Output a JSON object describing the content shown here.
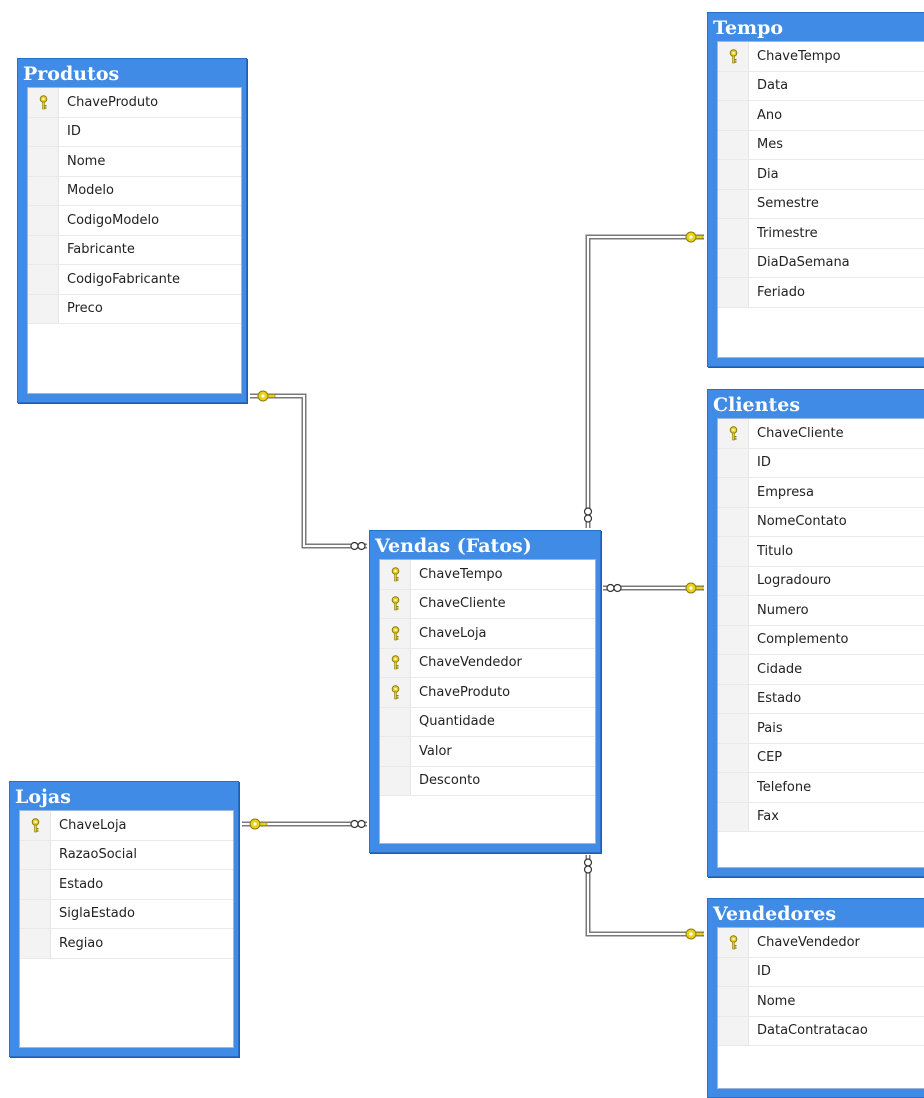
{
  "colors": {
    "table_frame": "#3f8be6",
    "table_title": "#ffffff",
    "key_icon": "#e8d21a",
    "connector": "#7a7a7a"
  },
  "tables": {
    "produtos": {
      "title": "Produtos",
      "columns": [
        {
          "name": "ChaveProduto",
          "key": true
        },
        {
          "name": "ID",
          "key": false
        },
        {
          "name": "Nome",
          "key": false
        },
        {
          "name": "Modelo",
          "key": false
        },
        {
          "name": "CodigoModelo",
          "key": false
        },
        {
          "name": "Fabricante",
          "key": false
        },
        {
          "name": "CodigoFabricante",
          "key": false
        },
        {
          "name": "Preco",
          "key": false
        }
      ]
    },
    "tempo": {
      "title": "Tempo",
      "columns": [
        {
          "name": "ChaveTempo",
          "key": true
        },
        {
          "name": "Data",
          "key": false
        },
        {
          "name": "Ano",
          "key": false
        },
        {
          "name": "Mes",
          "key": false
        },
        {
          "name": "Dia",
          "key": false
        },
        {
          "name": "Semestre",
          "key": false
        },
        {
          "name": "Trimestre",
          "key": false
        },
        {
          "name": "DiaDaSemana",
          "key": false
        },
        {
          "name": "Feriado",
          "key": false
        }
      ]
    },
    "clientes": {
      "title": "Clientes",
      "columns": [
        {
          "name": "ChaveCliente",
          "key": true
        },
        {
          "name": "ID",
          "key": false
        },
        {
          "name": "Empresa",
          "key": false
        },
        {
          "name": "NomeContato",
          "key": false
        },
        {
          "name": "Titulo",
          "key": false
        },
        {
          "name": "Logradouro",
          "key": false
        },
        {
          "name": "Numero",
          "key": false
        },
        {
          "name": "Complemento",
          "key": false
        },
        {
          "name": "Cidade",
          "key": false
        },
        {
          "name": "Estado",
          "key": false
        },
        {
          "name": "Pais",
          "key": false
        },
        {
          "name": "CEP",
          "key": false
        },
        {
          "name": "Telefone",
          "key": false
        },
        {
          "name": "Fax",
          "key": false
        }
      ]
    },
    "vendas": {
      "title": "Vendas (Fatos)",
      "columns": [
        {
          "name": "ChaveTempo",
          "key": true
        },
        {
          "name": "ChaveCliente",
          "key": true
        },
        {
          "name": "ChaveLoja",
          "key": true
        },
        {
          "name": "ChaveVendedor",
          "key": true
        },
        {
          "name": "ChaveProduto",
          "key": true
        },
        {
          "name": "Quantidade",
          "key": false
        },
        {
          "name": "Valor",
          "key": false
        },
        {
          "name": "Desconto",
          "key": false
        }
      ]
    },
    "lojas": {
      "title": "Lojas",
      "columns": [
        {
          "name": "ChaveLoja",
          "key": true
        },
        {
          "name": "RazaoSocial",
          "key": false
        },
        {
          "name": "Estado",
          "key": false
        },
        {
          "name": "SiglaEstado",
          "key": false
        },
        {
          "name": "Regiao",
          "key": false
        }
      ]
    },
    "vendedores": {
      "title": "Vendedores",
      "columns": [
        {
          "name": "ChaveVendedor",
          "key": true
        },
        {
          "name": "ID",
          "key": false
        },
        {
          "name": "Nome",
          "key": false
        },
        {
          "name": "DataContratacao",
          "key": false
        }
      ]
    }
  },
  "relationships": [
    {
      "from": "produtos",
      "to": "vendas"
    },
    {
      "from": "tempo",
      "to": "vendas"
    },
    {
      "from": "clientes",
      "to": "vendas"
    },
    {
      "from": "lojas",
      "to": "vendas"
    },
    {
      "from": "vendedores",
      "to": "vendas"
    }
  ]
}
